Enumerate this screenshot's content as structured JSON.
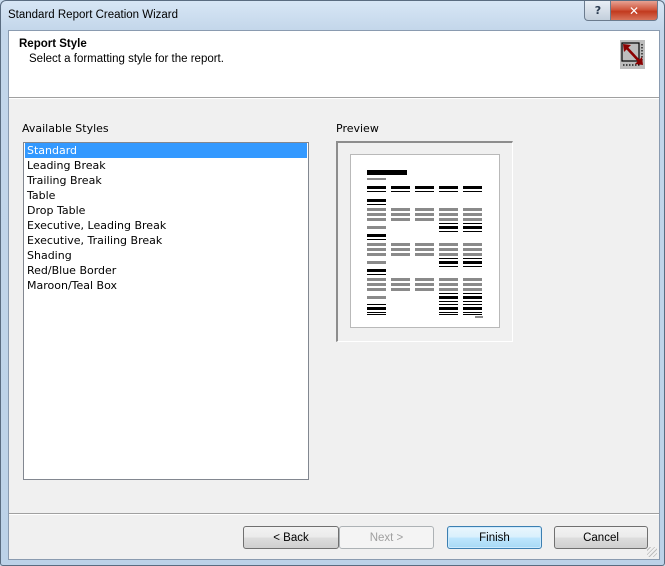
{
  "window": {
    "title": "Standard Report Creation Wizard",
    "help_label": "?",
    "close_label": "✕"
  },
  "header": {
    "title": "Report Style",
    "subtitle": "Select a formatting style for the report.",
    "icon": "report-style-resize-icon"
  },
  "styles": {
    "label": "Available Styles",
    "selected": "Standard",
    "items": [
      {
        "label": "Standard"
      },
      {
        "label": "Leading Break"
      },
      {
        "label": "Trailing Break"
      },
      {
        "label": "Table"
      },
      {
        "label": "Drop Table"
      },
      {
        "label": "Executive, Leading Break"
      },
      {
        "label": "Executive, Trailing Break"
      },
      {
        "label": "Shading"
      },
      {
        "label": "Red/Blue Border"
      },
      {
        "label": "Maroon/Teal Box"
      }
    ]
  },
  "preview": {
    "label": "Preview"
  },
  "buttons": {
    "back": "< Back",
    "next": "Next >",
    "finish": "Finish",
    "cancel": "Cancel"
  },
  "colors": {
    "selection": "#3399ff",
    "default_button_border": "#3c7fb1",
    "close_button": "#c23a1e"
  }
}
